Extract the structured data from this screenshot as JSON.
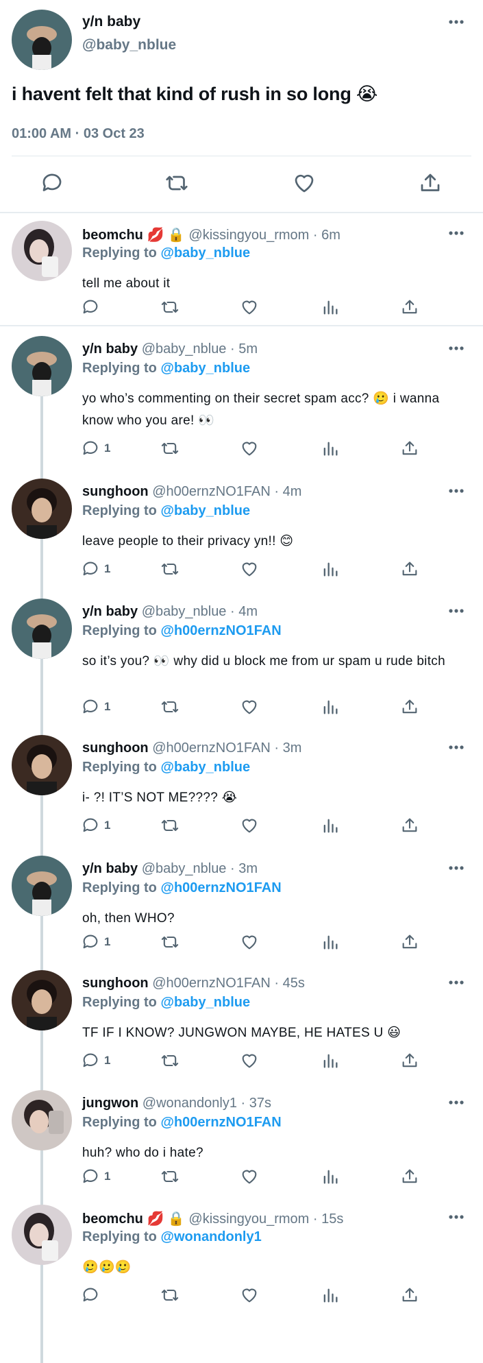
{
  "main_tweet": {
    "display_name": "y/n baby",
    "handle": "@baby_nblue",
    "text": "i havent felt that kind of rush in so long 😭",
    "timestamp": "01:00 AM · 03 Oct 23",
    "actions": [
      "reply-icon",
      "retweet-icon",
      "like-icon",
      "share-icon"
    ]
  },
  "replies": [
    {
      "name": "beomchu 💋 🔒",
      "handle": "@kissingyou_rmom · 6m",
      "replying_to": "@baby_nblue",
      "text": "tell me about it",
      "reply_count": "",
      "avatar": "beomchu"
    },
    {
      "name": "y/n baby",
      "handle": "@baby_nblue · 5m",
      "replying_to": "@baby_nblue",
      "text": "yo who’s commenting on their secret spam acc? 🥲 i wanna know who you are! 👀",
      "reply_count": "1",
      "avatar": "yn"
    },
    {
      "name": "sunghoon",
      "handle": "@h00ernzNO1FAN · 4m",
      "replying_to": "@baby_nblue",
      "text": "leave people to their privacy yn!! 😊",
      "reply_count": "1",
      "avatar": "sunghoon"
    },
    {
      "name": "y/n baby",
      "handle": "@baby_nblue · 4m",
      "replying_to": "@h00ernzNO1FAN",
      "text": "so it’s you? 👀 why did u block me from ur spam u rude bitch",
      "reply_count": "1",
      "avatar": "yn"
    },
    {
      "name": "sunghoon",
      "handle": "@h00ernzNO1FAN · 3m",
      "replying_to": "@baby_nblue",
      "text": "i- ?! IT’S NOT ME???? 😭",
      "reply_count": "1",
      "avatar": "sunghoon"
    },
    {
      "name": "y/n baby",
      "handle": "@baby_nblue · 3m",
      "replying_to": "@h00ernzNO1FAN",
      "text": "oh, then WHO?",
      "reply_count": "1",
      "avatar": "yn"
    },
    {
      "name": "sunghoon",
      "handle": "@h00ernzNO1FAN · 45s",
      "replying_to": "@baby_nblue",
      "text": "TF IF I KNOW? JUNGWON MAYBE, HE HATES U 😃",
      "reply_count": "1",
      "avatar": "sunghoon"
    },
    {
      "name": "jungwon",
      "handle": "@wonandonly1 · 37s",
      "replying_to": "@h00ernzNO1FAN",
      "text": "huh? who do i hate?",
      "reply_count": "1",
      "avatar": "jungwon"
    },
    {
      "name": "beomchu 💋 🔒",
      "handle": "@kissingyou_rmom · 15s",
      "replying_to": "@wonandonly1",
      "text": "🥲🥲🥲",
      "reply_count": "",
      "avatar": "beomchu"
    }
  ],
  "labels": {
    "replying_prefix": "Replying to "
  },
  "colors": {
    "link": "#1d9bf0",
    "muted": "#657786",
    "divider": "#e6ecf0",
    "thread_line": "#cfd9de"
  }
}
